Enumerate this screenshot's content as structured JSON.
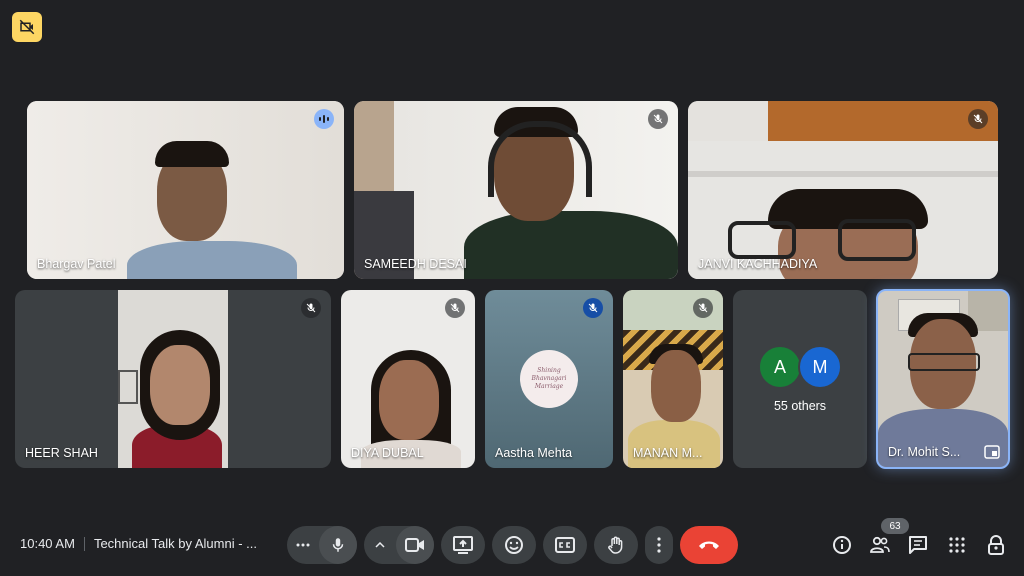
{
  "meeting": {
    "time": "10:40 AM",
    "title": "Technical Talk by Alumni - ..."
  },
  "participants": [
    {
      "name": "Bhargav Patel",
      "mic": "speaking"
    },
    {
      "name": "SAMEEDH DESAI",
      "mic": "muted"
    },
    {
      "name": "JANVI KACHHADIYA",
      "mic": "muted"
    },
    {
      "name": "HEER SHAH",
      "mic": "muted"
    },
    {
      "name": "DIYA DUBAL",
      "mic": "muted"
    },
    {
      "name": "Aastha Mehta",
      "mic": "muted"
    },
    {
      "name": "MANAN M...",
      "mic": "muted"
    },
    {
      "name": "Dr. Mohit S...",
      "mic": "pinned"
    }
  ],
  "others": {
    "label": "55 others",
    "avatars": [
      {
        "initial": "A",
        "color": "#188038"
      },
      {
        "initial": "M",
        "color": "#1967d2"
      }
    ]
  },
  "aastha_logo_text": "Shining Bhavnagari Marriage",
  "people_count": "63",
  "colors": {
    "background": "#202124",
    "control": "#3c4043",
    "end_call": "#ea4335",
    "active_border": "#8ab4f8",
    "recording_badge": "#fdd663"
  },
  "icons": {
    "recording": "no-video-icon",
    "more_options": "more-horizontal-icon",
    "microphone": "mic-icon",
    "chevron": "chevron-up-icon",
    "camera": "camera-icon",
    "present": "present-icon",
    "emoji": "emoji-icon",
    "captions": "captions-icon",
    "raise_hand": "hand-icon",
    "more_vert": "more-vertical-icon",
    "end_call": "phone-hangup-icon",
    "info": "info-icon",
    "people": "people-icon",
    "chat": "chat-icon",
    "activities": "apps-grid-icon",
    "host_controls": "lock-person-icon"
  }
}
